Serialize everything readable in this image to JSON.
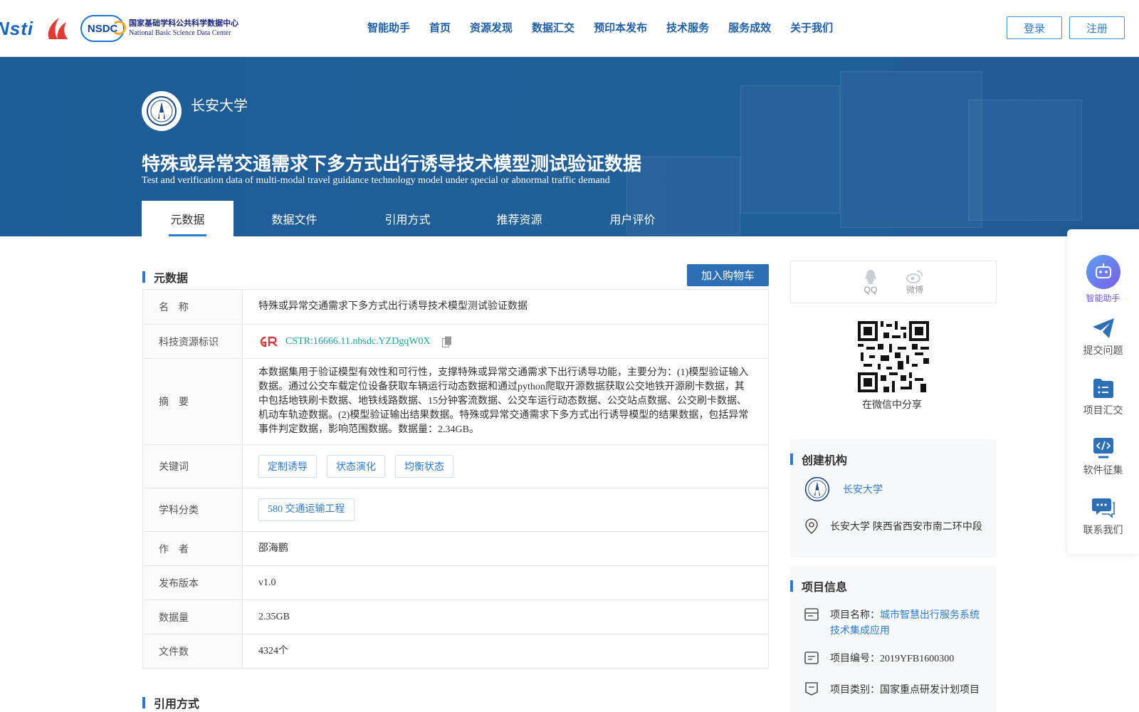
{
  "header": {
    "logo_nsti": "Nsti",
    "logo_nsdc_mark": "NSDC",
    "logo_nsdc_zh": "国家基础学科公共科学数据中心",
    "logo_nsdc_en": "National Basic Science Data Center",
    "nav": [
      "智能助手",
      "首页",
      "资源发现",
      "数据汇交",
      "预印本发布",
      "技术服务",
      "服务成效",
      "关于我们"
    ],
    "login": "登录",
    "register": "注册"
  },
  "banner": {
    "org_name": "长安大学",
    "title_zh": "特殊或异常交通需求下多方式出行诱导技术模型测试验证数据",
    "title_en": "Test and verification data of multi-modal travel guidance technology model under special or abnormal traffic demand",
    "tabs": [
      "元数据",
      "数据文件",
      "引用方式",
      "推荐资源",
      "用户评价"
    ]
  },
  "metadata": {
    "heading": "元数据",
    "cart_button": "加入购物车",
    "rows": {
      "name": {
        "label": "名　称",
        "value": "特殊或异常交通需求下多方式出行诱导技术模型测试验证数据"
      },
      "cstr": {
        "label": "科技资源标识",
        "value": "CSTR:16666.11.nbsdc.YZDgqW0X"
      },
      "abstract": {
        "label": "摘　要",
        "value": "本数据集用于验证模型有效性和可行性，支撑特殊或异常交通需求下出行诱导功能，主要分为：(1)模型验证输入数据。通过公交车载定位设备获取车辆运行动态数据和通过python爬取开源数据获取公交地铁开源刷卡数据，其中包括地铁刷卡数据、地铁线路数据、15分钟客流数据、公交车运行动态数据、公交站点数据、公交刷卡数据、机动车轨迹数据。(2)模型验证输出结果数据。特殊或异常交通需求下多方式出行诱导模型的结果数据，包括异常事件判定数据，影响范围数据。数据量：2.34GB。"
      },
      "keywords": {
        "label": "关键词",
        "values": [
          "定制诱导",
          "状态演化",
          "均衡状态"
        ]
      },
      "subject": {
        "label": "学科分类",
        "value": "580 交通运输工程"
      },
      "author": {
        "label": "作　者",
        "value": "邵海鹏"
      },
      "version": {
        "label": "发布版本",
        "value": "v1.0"
      },
      "size": {
        "label": "数据量",
        "value": "2.35GB"
      },
      "files": {
        "label": "文件数",
        "value": "4324个"
      }
    }
  },
  "citation_heading": "引用方式",
  "share": {
    "qq": "QQ",
    "weibo": "微博",
    "wechat_label": "在微信中分享"
  },
  "creator": {
    "heading": "创建机构",
    "org_name": "长安大学",
    "address": "长安大学 陕西省西安市南二环中段"
  },
  "project": {
    "heading": "项目信息",
    "name_label": "项目名称：",
    "name_value": "城市智慧出行服务系统技术集成应用",
    "code": "项目编号：2019YFB1600300",
    "category": "项目类别：国家重点研发计划项目"
  },
  "side": {
    "assistant": "智能助手",
    "submit": "提交问题",
    "project": "项目汇交",
    "software": "软件征集",
    "contact": "联系我们"
  },
  "colors": {
    "primary": "#2d7bd1",
    "banner": "#1d5c96",
    "accent_teal": "#1aa397",
    "cstr_red": "#d9363e"
  }
}
